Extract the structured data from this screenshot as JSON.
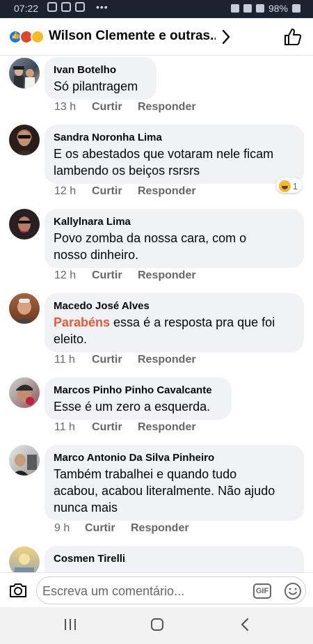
{
  "status_bar": {
    "time": "07:22",
    "battery": "98%"
  },
  "header": {
    "title": "Wilson Clemente e outras..."
  },
  "comments": [
    {
      "name": "Ivan Botelho",
      "lines": [
        "Só pilantragem"
      ],
      "time": "13 h",
      "like": "Curtir",
      "reply": "Responder"
    },
    {
      "name": "Sandra Noronha Lima",
      "lines": [
        "E os abestados que votaram nele ficam",
        "lambendo os beiços rsrsrs"
      ],
      "time": "12 h",
      "like": "Curtir",
      "reply": "Responder",
      "reaction_count": "1"
    },
    {
      "name": "Kallylnara Lima",
      "lines": [
        "Povo zomba da nossa cara, com o",
        "nosso dinheiro."
      ],
      "time": "12 h",
      "like": "Curtir",
      "reply": "Responder"
    },
    {
      "name": "Macedo José Alves",
      "mention": "Parabéns",
      "lines": [
        " essa é a resposta pra que foi",
        "eleito."
      ],
      "time": "11 h",
      "like": "Curtir",
      "reply": "Responder"
    },
    {
      "name": "Marcos Pinho Pinho Cavalcante",
      "lines": [
        "Esse é um zero a esquerda."
      ],
      "time": "11 h",
      "like": "Curtir",
      "reply": "Responder"
    },
    {
      "name": "Marco Antonio Da Silva Pinheiro",
      "lines": [
        "Também trabalhei e quando tudo",
        "acabou, acabou literalmente. Não ajudo",
        "nunca mais"
      ],
      "time": "9 h",
      "like": "Curtir",
      "reply": "Responder"
    },
    {
      "name": "Cosmen Tirelli"
    }
  ],
  "composer": {
    "placeholder": "Escreva um comentário...",
    "gif_label": "GIF"
  },
  "colors": {
    "mention": "#e8593a",
    "bubble": "#f0f2f5",
    "meta": "#65676b",
    "like_blue": "#1877f2"
  }
}
